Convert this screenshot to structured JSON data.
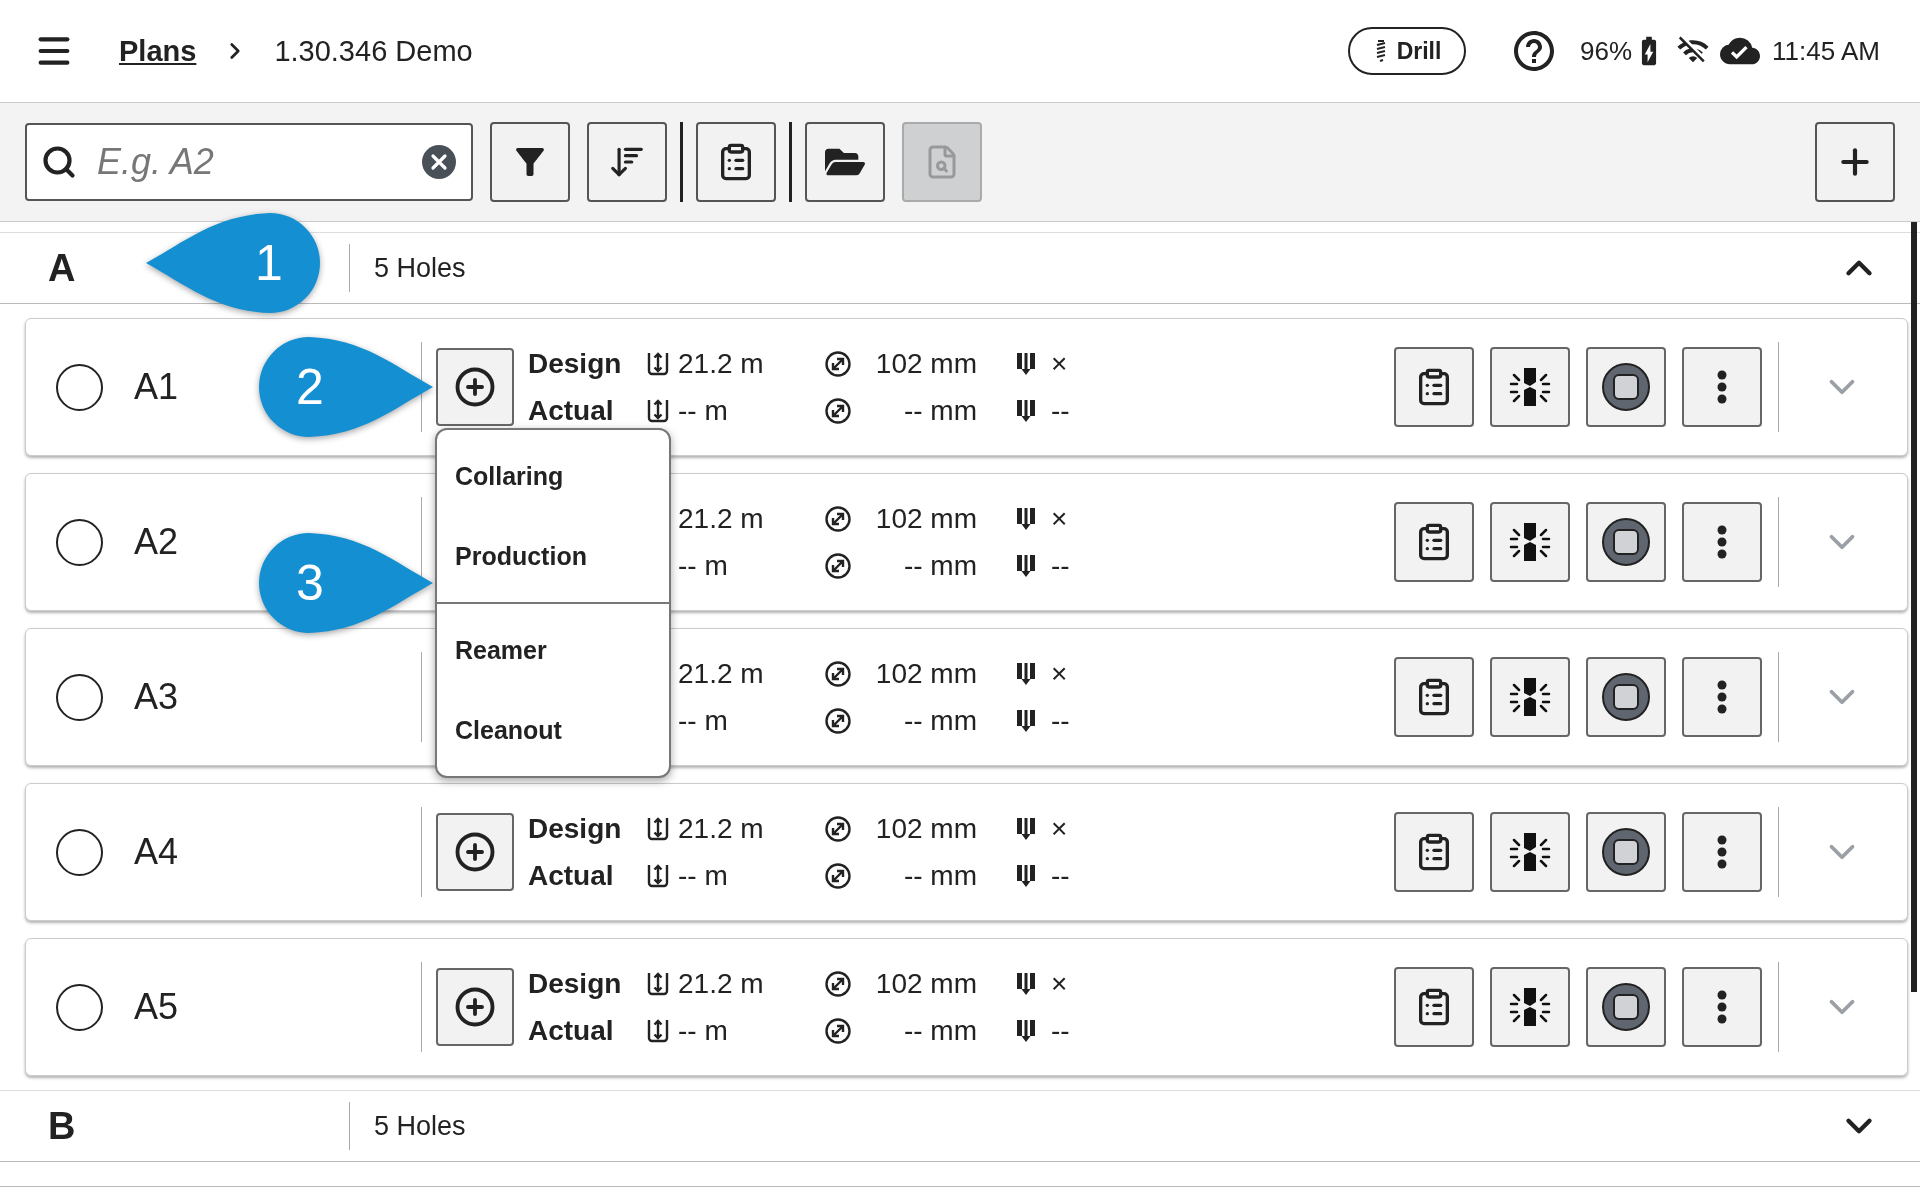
{
  "top_bar": {
    "breadcrumb": [
      {
        "label": "Plans",
        "link": true
      },
      {
        "label": "1.30.346 Demo",
        "link": false
      }
    ],
    "mode": "Drill",
    "battery": "96%",
    "time": "11:45 AM"
  },
  "toolbar": {
    "search": {
      "placeholder": "E.g. A2"
    },
    "button_groups": [
      [
        {
          "kind": "filter",
          "disabled": false
        },
        {
          "kind": "sort",
          "disabled": false
        }
      ],
      [
        {
          "kind": "notes",
          "disabled": false
        }
      ],
      [
        {
          "kind": "folder",
          "disabled": false
        },
        {
          "kind": "preview",
          "disabled": true
        }
      ]
    ]
  },
  "groups": [
    {
      "name": "A",
      "count": "5 Holes",
      "expanded": true,
      "holes": [
        {
          "id": "A1",
          "selected": false,
          "design": {
            "label": "Design",
            "depth": "21.2 m",
            "diameter": "102 mm",
            "pull": "×"
          },
          "actual": {
            "label": "Actual",
            "depth": "-- m",
            "diameter": "-- mm",
            "pull": "--"
          }
        },
        {
          "id": "A2",
          "selected": false,
          "design": {
            "depth": "21.2 m",
            "diameter": "102 mm",
            "pull": "×"
          },
          "actual": {
            "depth": "-- m",
            "diameter": "-- mm",
            "pull": "--"
          }
        },
        {
          "id": "A3",
          "selected": false,
          "design": {
            "depth": "21.2 m",
            "diameter": "102 mm",
            "pull": "×"
          },
          "actual": {
            "depth": "-- m",
            "diameter": "-- mm",
            "pull": "--"
          }
        },
        {
          "id": "A4",
          "selected": false,
          "design": {
            "label": "Design",
            "depth": "21.2 m",
            "diameter": "102 mm",
            "pull": "×"
          },
          "actual": {
            "label": "Actual",
            "depth": "-- m",
            "diameter": "-- mm",
            "pull": "--"
          }
        },
        {
          "id": "A5",
          "selected": false,
          "design": {
            "label": "Design",
            "depth": "21.2 m",
            "diameter": "102 mm",
            "pull": "×"
          },
          "actual": {
            "label": "Actual",
            "depth": "-- m",
            "diameter": "-- mm",
            "pull": "--"
          }
        }
      ]
    },
    {
      "name": "B",
      "count": "5 Holes",
      "expanded": false
    }
  ],
  "menu": {
    "groups": [
      [
        "Collaring",
        "Production"
      ],
      [
        "Reamer",
        "Cleanout"
      ]
    ]
  },
  "callouts": [
    {
      "number": "1"
    },
    {
      "number": "2"
    },
    {
      "number": "3"
    }
  ]
}
